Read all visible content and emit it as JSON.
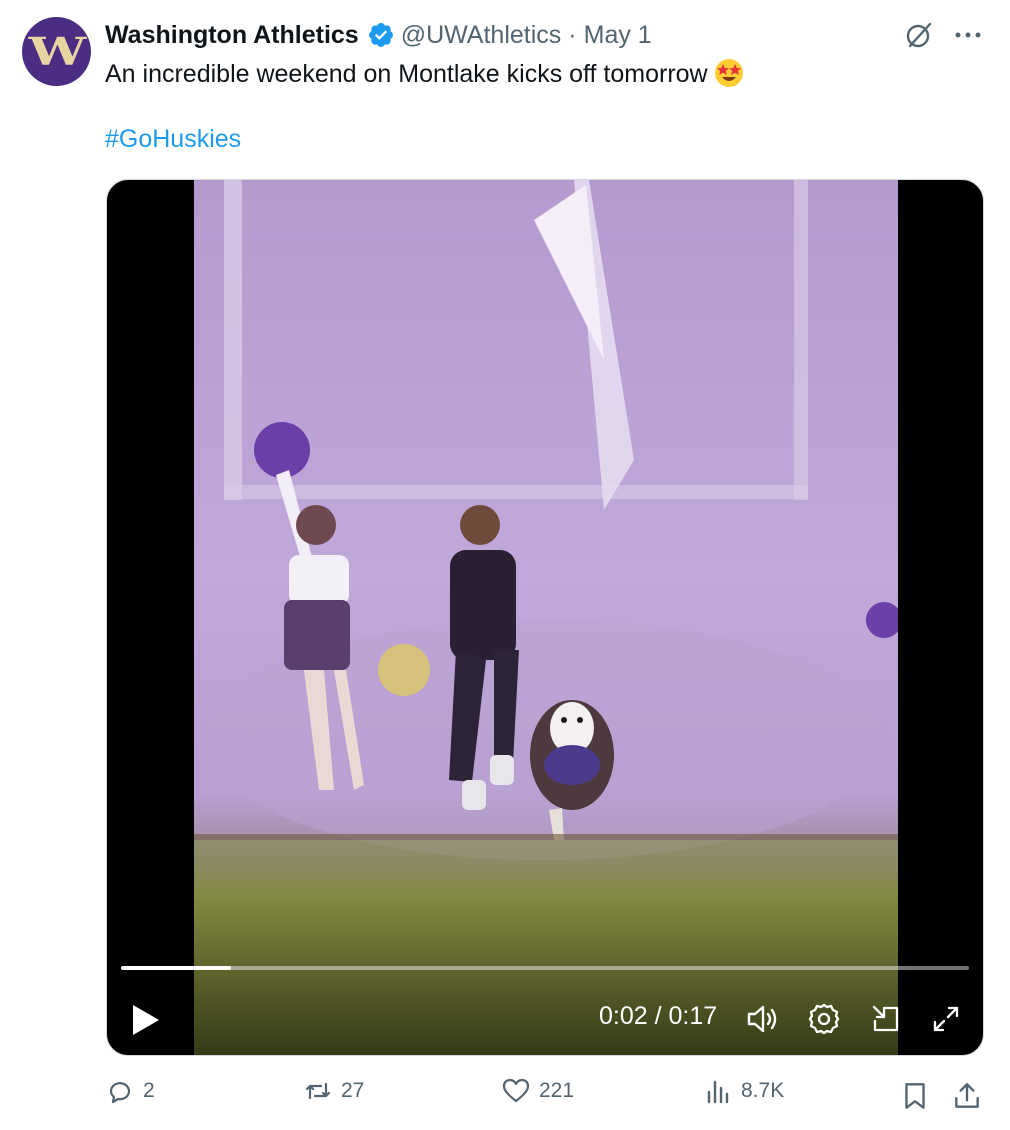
{
  "author": {
    "display_name": "Washington Athletics",
    "handle": "@UWAthletics",
    "separator": "·",
    "date": "May 1",
    "avatar_letter": "W",
    "verified": true
  },
  "post": {
    "text": "An incredible weekend on Montlake kicks off tomorrow",
    "emoji": "star-struck-emoji",
    "hashtag": "#GoHuskies"
  },
  "video": {
    "current_time": "0:02",
    "total_time": "0:17",
    "time_display": "0:02 / 0:17",
    "progress_fraction": 0.13,
    "state": "paused"
  },
  "actions": {
    "replies": "2",
    "reposts": "27",
    "likes": "221",
    "views": "8.7K"
  },
  "colors": {
    "accent": "#1d9bf0",
    "uw_purple": "#4b2e83",
    "uw_gold": "#e8d3a2",
    "muted_text": "#536471"
  },
  "icons": [
    "verified-badge-icon",
    "grok-icon",
    "more-icon",
    "play-icon",
    "volume-icon",
    "settings-icon",
    "pip-icon",
    "fullscreen-icon",
    "reply-icon",
    "repost-icon",
    "like-icon",
    "views-icon",
    "bookmark-icon",
    "share-icon"
  ]
}
